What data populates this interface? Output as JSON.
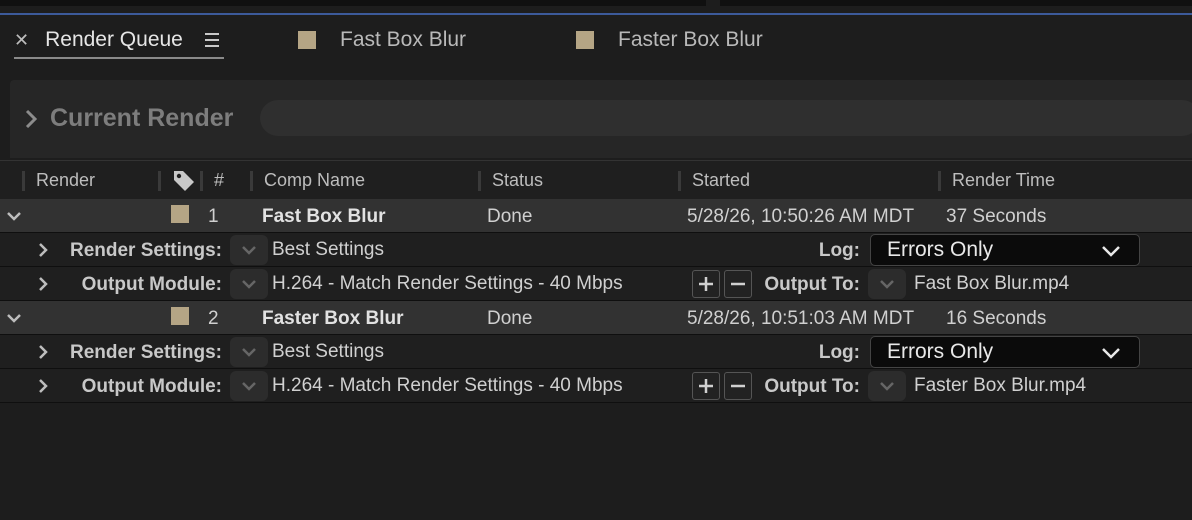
{
  "tabs": [
    {
      "label": "Render Queue",
      "active": true
    },
    {
      "label": "Fast Box Blur",
      "active": false
    },
    {
      "label": "Faster Box Blur",
      "active": false
    }
  ],
  "current_render": {
    "label": "Current Render"
  },
  "columns": {
    "render": "Render",
    "number": "#",
    "comp_name": "Comp Name",
    "status": "Status",
    "started": "Started",
    "render_time": "Render Time"
  },
  "labels": {
    "render_settings": "Render Settings:",
    "output_module": "Output Module:",
    "log": "Log:",
    "output_to": "Output To:"
  },
  "items": [
    {
      "number": "1",
      "comp_name": "Fast Box Blur",
      "status": "Done",
      "started": "5/28/26, 10:50:26 AM MDT",
      "render_time": "37 Seconds",
      "render_settings": "Best Settings",
      "log": "Errors Only",
      "output_module": "H.264 - Match Render Settings - 40 Mbps",
      "output_to": "Fast Box Blur.mp4"
    },
    {
      "number": "2",
      "comp_name": "Faster Box Blur",
      "status": "Done",
      "started": "5/28/26, 10:51:03 AM MDT",
      "render_time": "16 Seconds",
      "render_settings": "Best Settings",
      "log": "Errors Only",
      "output_module": "H.264 - Match Render Settings - 40 Mbps",
      "output_to": "Faster Box Blur.mp4"
    }
  ],
  "colors": {
    "label_swatch": "#b5a585",
    "accent_line": "#3c5a9a"
  }
}
